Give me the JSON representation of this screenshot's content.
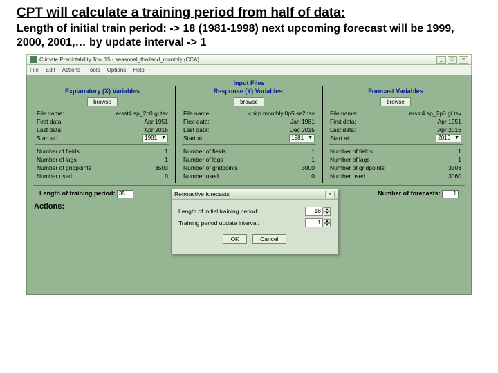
{
  "slide": {
    "title": "CPT will calculate a training period from half of data:",
    "sub": "Length of initial train period: -> 18 (1981-1998) next upcoming forecast will be 1999, 2000, 2001,… by update interval -> 1"
  },
  "window": {
    "title": "Climate Predictability Tool 15 - seasonal_thailand_monthly (CCA)",
    "menus": [
      "File",
      "Edit",
      "Actions",
      "Tools",
      "Options",
      "Help"
    ]
  },
  "header": {
    "input": "Input Files",
    "x": "Explanatory (X) Variables",
    "y": "Response (Y) Variables:",
    "f": "Forecast Variables",
    "browse": "browse"
  },
  "x": {
    "file": "ersst4.sp_2p0.gl.tsv",
    "first": "Apr 1951",
    "last": "Apr 2016",
    "start": "1981",
    "fields": "1",
    "lags": "1",
    "grid": "3503",
    "used": "0"
  },
  "y": {
    "file": "chirp.monthly.0p5.se2.tsv",
    "first": "Jan 1981",
    "last": "Dec 2015",
    "start": "1981",
    "fields": "1",
    "lags": "1",
    "grid": "3000",
    "used": "0"
  },
  "f": {
    "file": "ersst4.sp_2p0.gl.tsv",
    "first": "Apr 1951",
    "last": "Apr 2016",
    "start": "2016",
    "fields": "1",
    "lags": "1",
    "grid": "3503",
    "used": "3060"
  },
  "labels": {
    "filename": "File name:",
    "firstdata": "First data:",
    "lastdata": "Last data:",
    "startat": "Start at:",
    "nfields": "Number of fields",
    "nlags": "Number of lags",
    "ngrid": "Number of gridpoints",
    "nused": "Number used"
  },
  "bottom": {
    "lenlabel": "Length of training period:",
    "lenval": "35",
    "nflabel": "Number of forecasts:",
    "nfval": "1",
    "actions": "Actions:"
  },
  "modal": {
    "title": "Retroactive forecasts",
    "row1": "Length of initial training period:",
    "val1": "18",
    "row2": "Training period update interval:",
    "val2": "1",
    "ok": "OK",
    "cancel": "Cancel"
  }
}
